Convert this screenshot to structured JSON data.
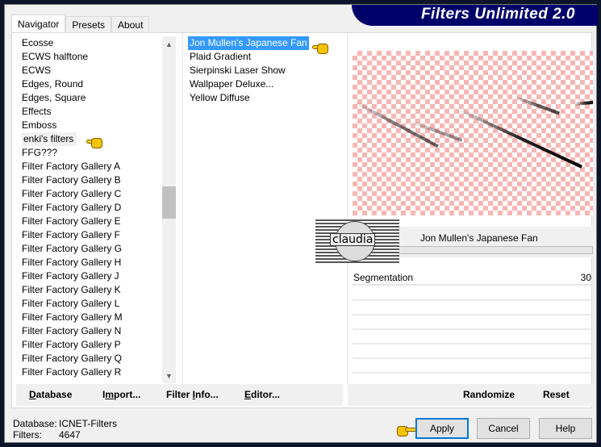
{
  "title": "Filters Unlimited 2.0",
  "tabs": [
    "Navigator",
    "Presets",
    "About"
  ],
  "categories": [
    "Ecosse",
    "ECWS halftone",
    "ECWS",
    "Edges, Round",
    "Edges, Square",
    "Effects",
    "Emboss",
    "enki's filters",
    "FFG???",
    "Filter Factory Gallery A",
    "Filter Factory Gallery B",
    "Filter Factory Gallery C",
    "Filter Factory Gallery D",
    "Filter Factory Gallery E",
    "Filter Factory Gallery F",
    "Filter Factory Gallery G",
    "Filter Factory Gallery H",
    "Filter Factory Gallery J",
    "Filter Factory Gallery K",
    "Filter Factory Gallery L",
    "Filter Factory Gallery M",
    "Filter Factory Gallery N",
    "Filter Factory Gallery P",
    "Filter Factory Gallery Q",
    "Filter Factory Gallery R"
  ],
  "highlighted_category": "enki's filters",
  "filters": [
    "Jon Mullen's Japanese Fan",
    "Plaid Gradient",
    "Sierpinski Laser Show",
    "Wallpaper Deluxe...",
    "Yellow Diffuse"
  ],
  "selected_filter": "Jon Mullen's Japanese Fan",
  "filter_name": "Jon Mullen's Japanese Fan",
  "logo_text": "claudia",
  "params": [
    {
      "label": "Segmentation",
      "value": "30"
    }
  ],
  "left_buttons": [
    {
      "label": "Database",
      "u": "D"
    },
    {
      "label": "Import...",
      "u": "m"
    },
    {
      "label": "Filter Info...",
      "u": "I"
    },
    {
      "label": "Editor...",
      "u": "E"
    }
  ],
  "right_buttons": [
    "Randomize",
    "Reset"
  ],
  "status": {
    "db_label": "Database:",
    "db_value": "ICNET-Filters",
    "filters_label": "Filters:",
    "filters_value": "4647"
  },
  "dialog_buttons": [
    "Apply",
    "Cancel",
    "Help"
  ],
  "colors": {
    "selection": "#3399ff",
    "banner": "#00006b",
    "checker": "#f7b6b6"
  }
}
